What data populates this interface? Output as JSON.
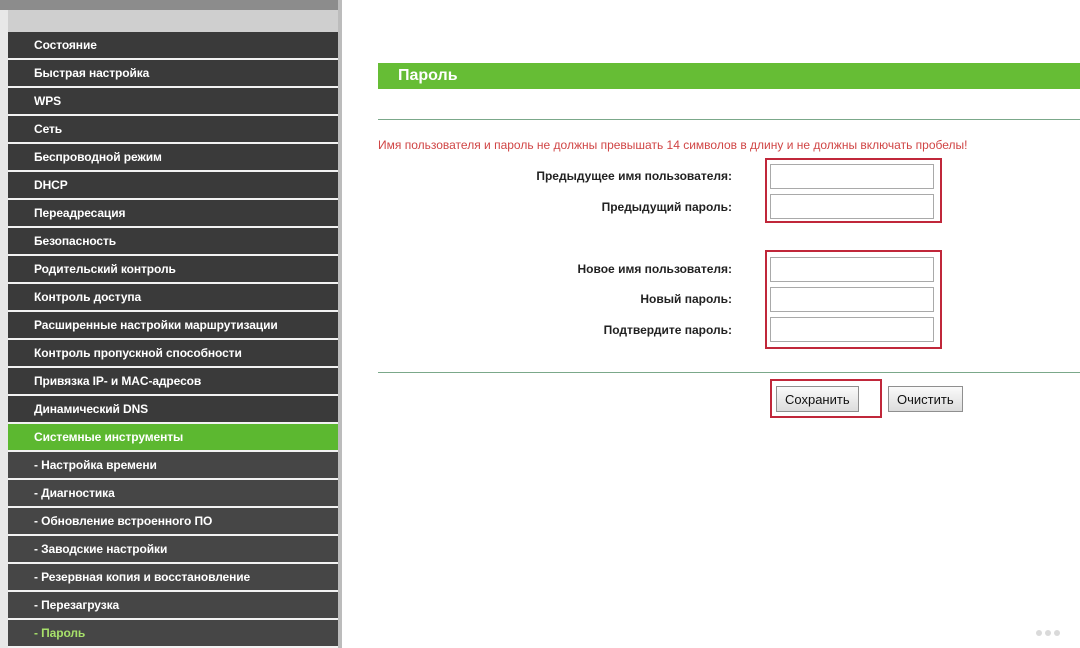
{
  "sidebar": {
    "items": [
      {
        "label": "Состояние"
      },
      {
        "label": "Быстрая настройка"
      },
      {
        "label": "WPS"
      },
      {
        "label": "Сеть"
      },
      {
        "label": "Беспроводной режим"
      },
      {
        "label": "DHCP"
      },
      {
        "label": "Переадресация"
      },
      {
        "label": "Безопасность"
      },
      {
        "label": "Родительский контроль"
      },
      {
        "label": "Контроль доступа"
      },
      {
        "label": "Расширенные настройки маршрутизации"
      },
      {
        "label": "Контроль пропускной способности"
      },
      {
        "label": "Привязка IP- и MAC-адресов"
      },
      {
        "label": "Динамический DNS"
      },
      {
        "label": "Системные инструменты"
      }
    ],
    "subitems": [
      {
        "label": "- Настройка времени"
      },
      {
        "label": "- Диагностика"
      },
      {
        "label": "- Обновление встроенного ПО"
      },
      {
        "label": "- Заводские настройки"
      },
      {
        "label": "- Резервная копия и восстановление"
      },
      {
        "label": "- Перезагрузка"
      },
      {
        "label": "- Пароль"
      }
    ],
    "active_item": "Системные инструменты",
    "current_subitem": "- Пароль"
  },
  "page": {
    "title": "Пароль",
    "warning": "Имя пользователя и пароль не должны превышать 14 символов в длину и не должны включать пробелы!"
  },
  "form": {
    "old_username_label": "Предыдущее имя пользователя:",
    "old_password_label": "Предыдущий пароль:",
    "new_username_label": "Новое имя пользователя:",
    "new_password_label": "Новый пароль:",
    "confirm_password_label": "Подтвердите пароль:",
    "old_username_value": "",
    "old_password_value": "",
    "new_username_value": "",
    "new_password_value": "",
    "confirm_password_value": ""
  },
  "buttons": {
    "save": "Сохранить",
    "clear": "Очистить"
  },
  "colors": {
    "accent_green": "#66bd35",
    "menu_dark": "#3a3a3a",
    "highlight_red": "#c0273a",
    "warning_red": "#d04545"
  }
}
